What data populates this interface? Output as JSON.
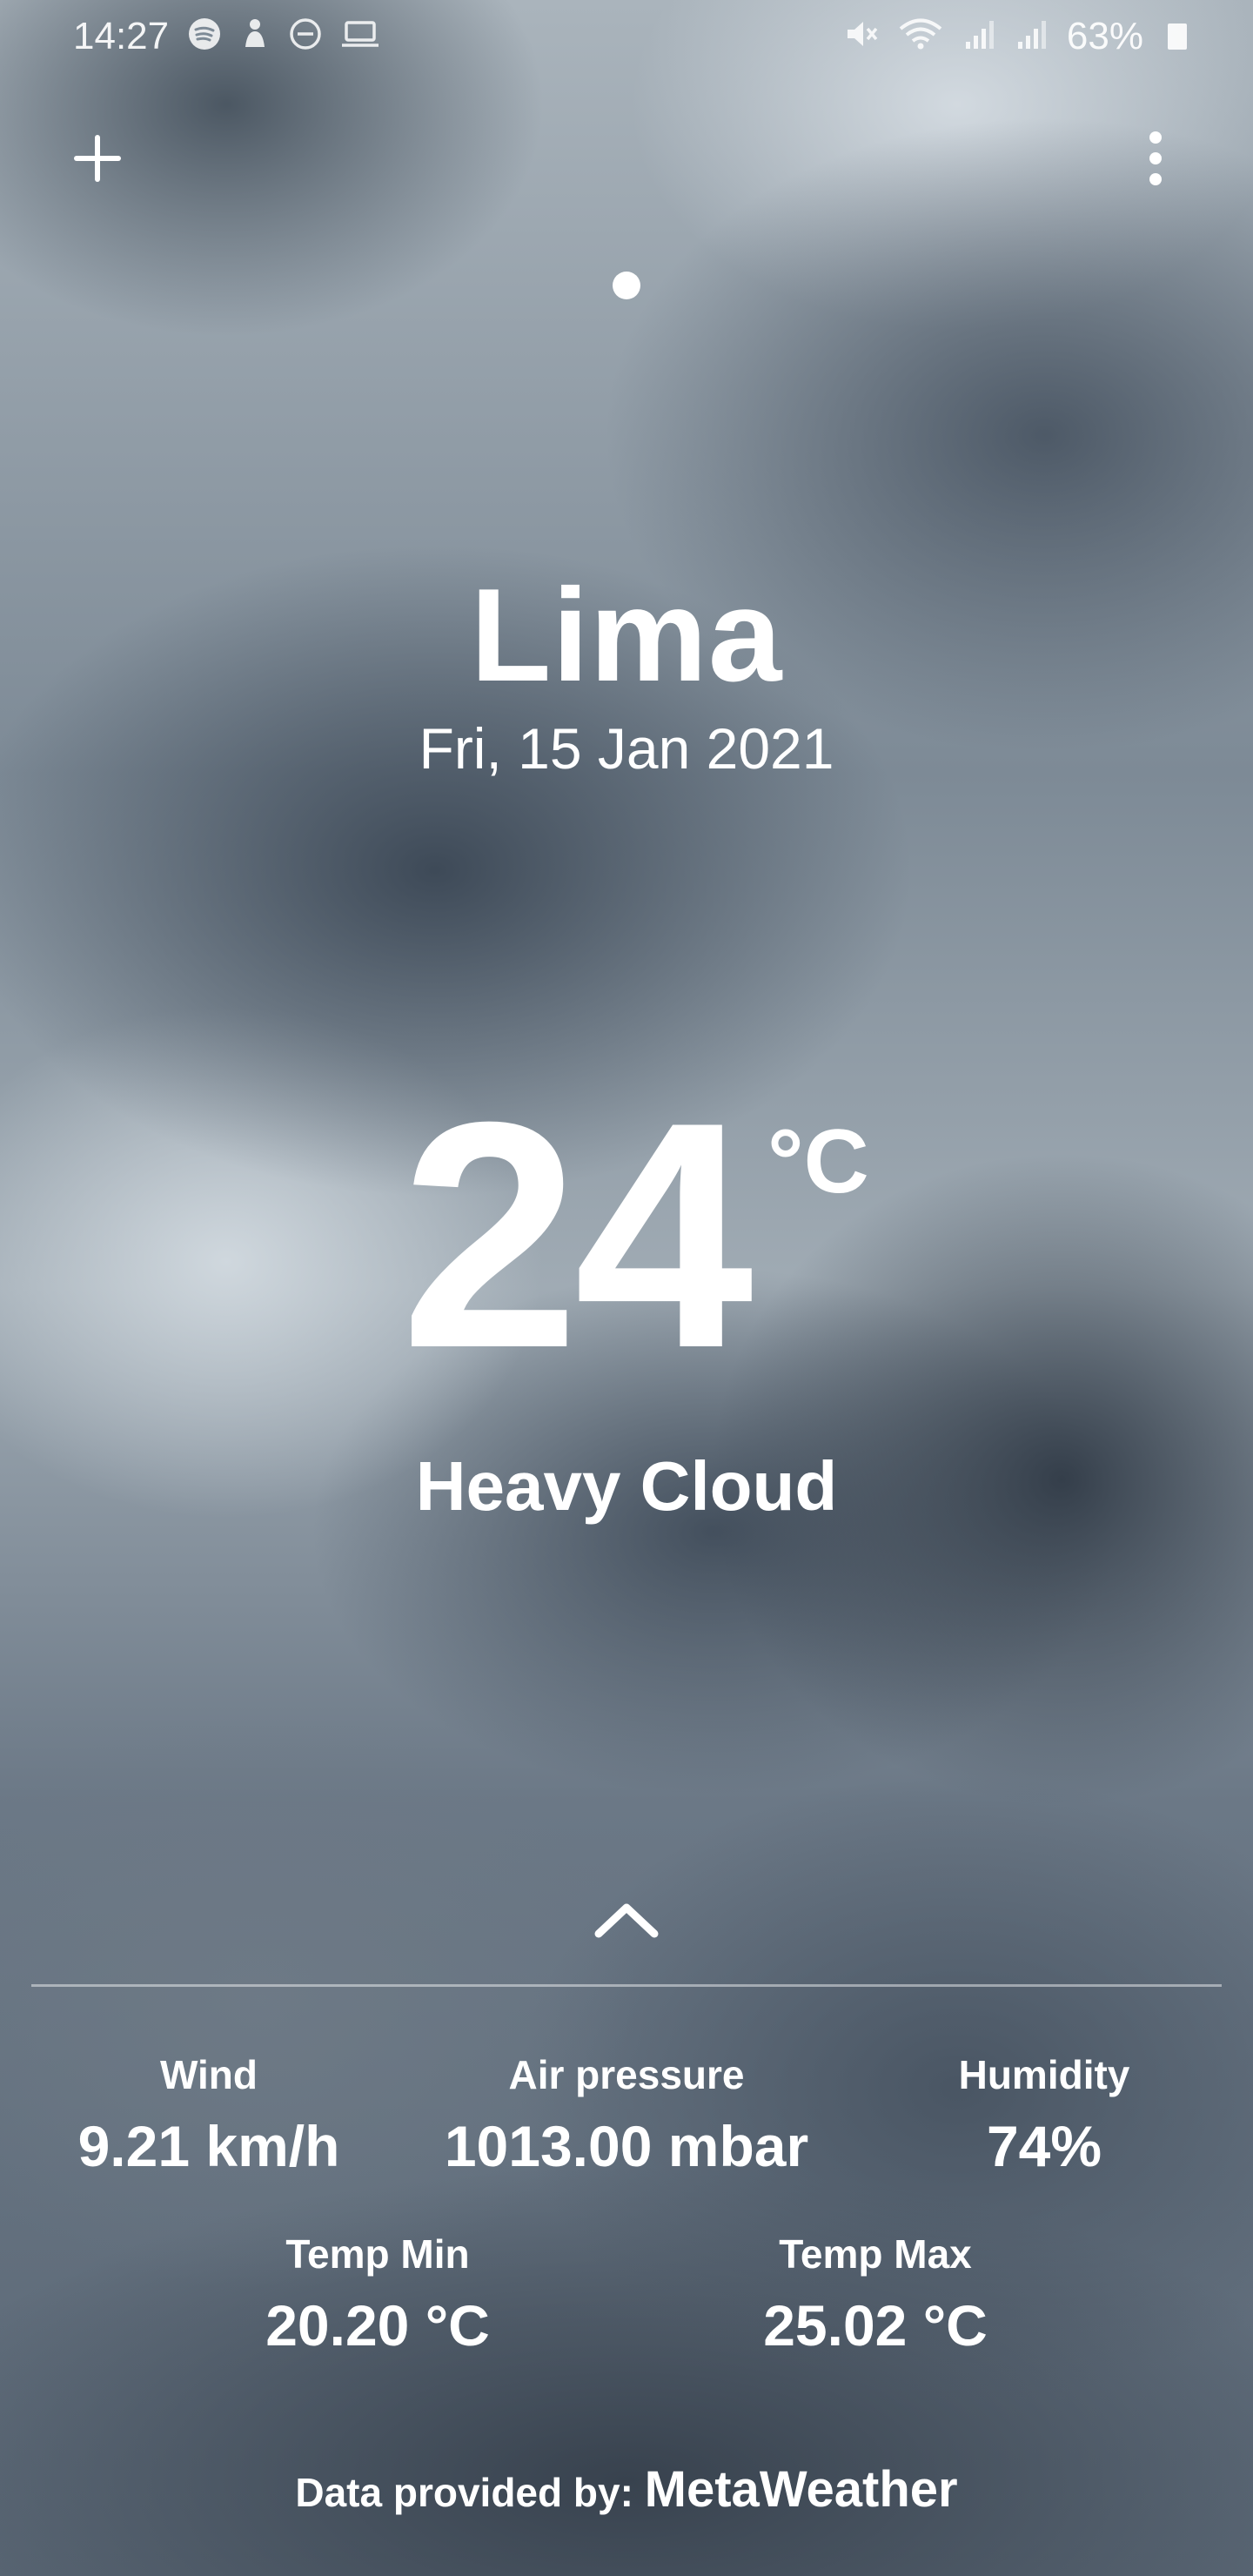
{
  "status_bar": {
    "time": "14:27",
    "left_icons": [
      "spotify-icon",
      "notification-icon",
      "dnd-icon",
      "laptop-icon"
    ],
    "right_icons": [
      "mute-icon",
      "wifi-icon",
      "signal-1-icon",
      "signal-2-icon"
    ],
    "battery": "63%"
  },
  "toolbar": {
    "add_icon": "plus-icon",
    "menu_icon": "more-vertical-icon"
  },
  "page_indicator": {
    "count": 1,
    "active_index": 0
  },
  "location": {
    "city": "Lima",
    "date": "Fri, 15 Jan 2021"
  },
  "current": {
    "temperature": "24",
    "unit": "°C",
    "condition": "Heavy Cloud"
  },
  "details": {
    "expand_icon": "chevron-up-icon",
    "wind": {
      "label": "Wind",
      "value": "9.21 km/h"
    },
    "air_pressure": {
      "label": "Air pressure",
      "value": "1013.00 mbar"
    },
    "humidity": {
      "label": "Humidity",
      "value": "74%"
    },
    "temp_min": {
      "label": "Temp Min",
      "value": "20.20 °C"
    },
    "temp_max": {
      "label": "Temp Max",
      "value": "25.02 °C"
    }
  },
  "footer": {
    "credit_prefix": "Data provided by:",
    "credit_source": "MetaWeather"
  },
  "colors": {
    "text": "#ffffff",
    "divider": "#ffffff"
  }
}
